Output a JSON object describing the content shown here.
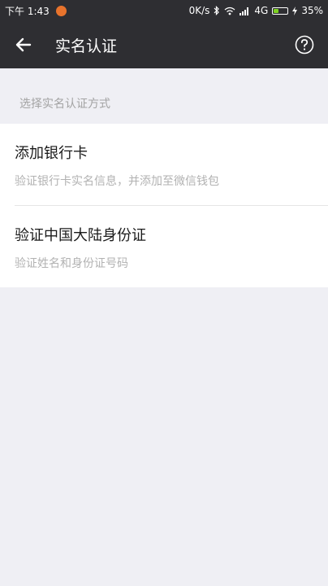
{
  "status_bar": {
    "time": "下午 1:43",
    "speed": "0K/s",
    "network": "4G",
    "battery_percent": "35%",
    "battery_level": 0.35
  },
  "header": {
    "title": "实名认证"
  },
  "section_label": "选择实名认证方式",
  "methods": [
    {
      "title": "添加银行卡",
      "description": "验证银行卡实名信息，并添加至微信钱包"
    },
    {
      "title": "验证中国大陆身份证",
      "description": "验证姓名和身份证号码"
    }
  ],
  "colors": {
    "header_bg": "#2e2e32",
    "page_bg": "#efeff4",
    "notification_dot": "#e8732c",
    "battery_fill": "#7ed321"
  },
  "icons": {
    "back": "arrow-left-icon",
    "help": "question-circle-icon",
    "bluetooth": "bluetooth-icon",
    "wifi": "wifi-icon",
    "signal": "signal-icon",
    "charging": "bolt-icon"
  }
}
